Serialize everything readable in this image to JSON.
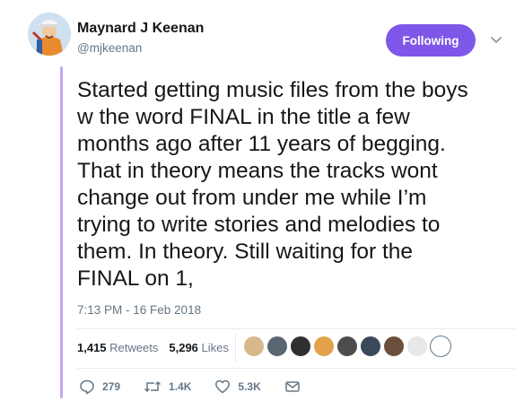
{
  "colors": {
    "accent": "#7e57e8",
    "thread_line": "#c4a8f4",
    "muted_text": "#657786",
    "primary_text": "#14171a"
  },
  "author": {
    "name": "Maynard J Keenan",
    "handle": "@mjkeenan",
    "avatar_icon": "avatar-cartoon-icon"
  },
  "follow_button": {
    "label": "Following"
  },
  "caret_icon": "chevron-down-icon",
  "tweet": {
    "lines": [
      "Started getting music files from the boys",
      "w the word FINAL in the title a few",
      "months ago after 11 years of begging.",
      "That in theory means the tracks wont",
      "change out from under me while I’m",
      "trying to write stories and melodies to",
      "them. In theory. Still waiting for the",
      "FINAL on 1,"
    ],
    "timestamp": "7:13 PM - 16 Feb 2018"
  },
  "stats": {
    "retweets_count": "1,415",
    "retweets_label": "Retweets",
    "likes_count": "5,296",
    "likes_label": "Likes"
  },
  "liker_avatars": [
    "#d8b78a",
    "#5a6672",
    "#2f2f2f",
    "#e3a24a",
    "#4d4d4d",
    "#3a4a5a",
    "#6b4f3a",
    "#e8e8e8",
    "#ffffff"
  ],
  "actions": {
    "reply_count": "279",
    "retweet_count": "1.4K",
    "like_count": "5.3K",
    "reply_icon": "reply-icon",
    "retweet_icon": "retweet-icon",
    "like_icon": "heart-icon",
    "dm_icon": "envelope-icon"
  }
}
